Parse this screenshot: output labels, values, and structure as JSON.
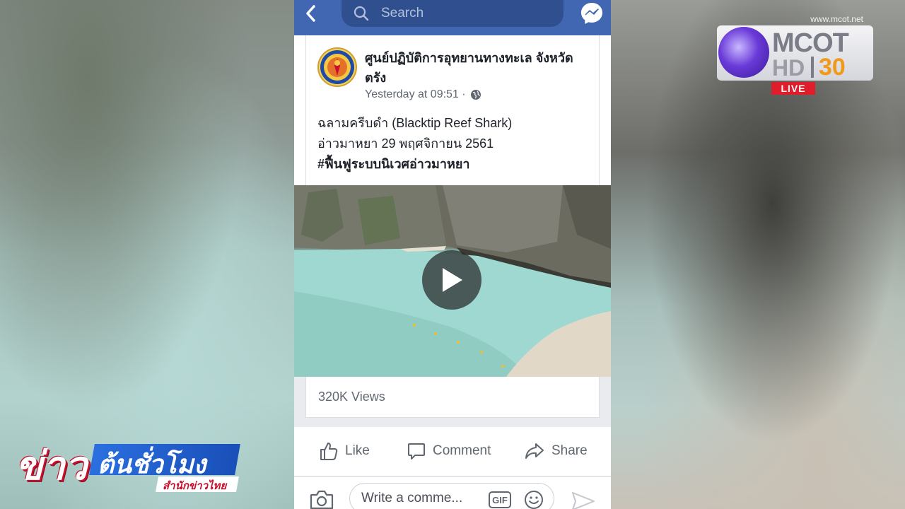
{
  "topbar": {
    "search_placeholder": "Search"
  },
  "post": {
    "page_name": "ศูนย์ปฏิบัติการอุทยานทางทะเล จังหวัดตรัง",
    "timestamp": "Yesterday at 09:51 ·",
    "lines": [
      "ฉลามครีบดำ  (Blacktip Reef Shark)",
      "อ่าวมาหยา 29 พฤศจิกายน 2561"
    ],
    "hashtag": "#ฟื้นฟูระบบนิเวศอ่าวมาหยา",
    "views": "320K Views"
  },
  "actions": {
    "like": "Like",
    "comment": "Comment",
    "share": "Share"
  },
  "comment_box": {
    "placeholder": "Write a comme...",
    "gif": "GIF"
  },
  "broadcaster": {
    "url": "www.mcot.net",
    "brand": "MCOT",
    "hd": "HD",
    "channel": "30",
    "live": "LIVE"
  },
  "news_logo": {
    "part1": "ข่าว",
    "part2": "ต้นชั่วโมง",
    "part3": "สำนักข่าวไทย"
  },
  "colors": {
    "facebook_blue": "#4267b2",
    "live_red": "#e01d2a",
    "channel_orange": "#f09a1a"
  },
  "icons": {
    "back": "chevron-left-icon",
    "search": "search-icon",
    "messenger": "messenger-icon",
    "privacy": "globe-icon",
    "play": "play-icon",
    "like": "thumbs-up-icon",
    "comment": "speech-bubble-icon",
    "share": "share-arrow-icon",
    "camera": "camera-icon",
    "emoji": "smiley-icon",
    "send": "send-icon"
  }
}
